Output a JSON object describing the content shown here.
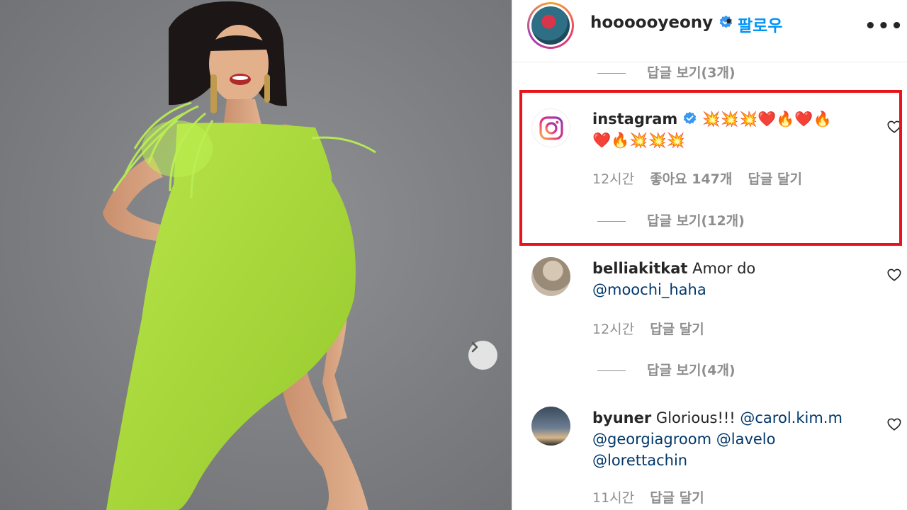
{
  "header": {
    "username": "hoooooyeony",
    "separator": "•",
    "follow_label": "팔로우",
    "more_label": "•••"
  },
  "top_replies": {
    "label": "답글 보기(3개)"
  },
  "comments": [
    {
      "username": "instagram",
      "verified": true,
      "text_line1": "💥💥💥❤️🔥❤️🔥",
      "text_line2": "❤️🔥💥💥💥",
      "time": "12시간",
      "likes": "좋아요 147개",
      "reply_label": "답글 달기",
      "view_replies": "답글 보기(12개)"
    },
    {
      "username": "belliakitkat",
      "text": "Amor do",
      "mention1": "@moochi_haha",
      "time": "12시간",
      "reply_label": "답글 달기",
      "view_replies": "답글 보기(4개)"
    },
    {
      "username": "byuner",
      "text": "Glorious!!!",
      "mention1": "@carol.kim.m",
      "mention2": "@georgiagroom",
      "mention3": "@lavelo",
      "mention4": "@lorettachin",
      "time": "11시간",
      "reply_label": "답글 달기"
    }
  ],
  "colors": {
    "follow": "#0095f6",
    "verified": "#3897f0",
    "highlight_box": "#e8141a",
    "dress": "#a8d93a",
    "meta_text": "#8e8e8e",
    "mention": "#00376b"
  },
  "icons": {
    "verified": "verified-badge-icon",
    "heart": "heart-outline-icon",
    "next": "chevron-right-icon",
    "instagram": "instagram-logo-icon"
  }
}
